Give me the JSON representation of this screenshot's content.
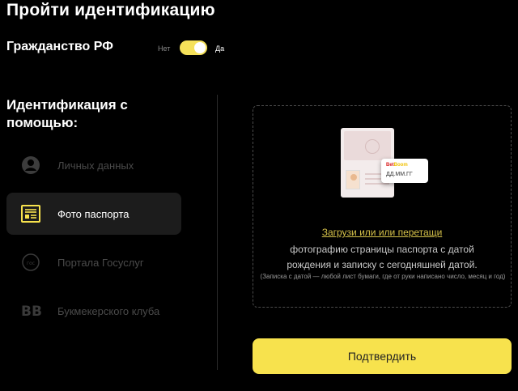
{
  "page": {
    "title": "Пройти идентификацию"
  },
  "citizenship": {
    "label": "Гражданство РФ",
    "toggle_no": "Нет",
    "toggle_yes": "Да",
    "enabled": true
  },
  "methods_heading": "Идентификация с помощью:",
  "methods": [
    {
      "label": "Личных данных",
      "icon": "person-icon",
      "active": false
    },
    {
      "label": "Фото паспорта",
      "icon": "passport-icon",
      "active": true
    },
    {
      "label": "Портала Госуслуг",
      "icon": "gosuslugi-icon",
      "active": false
    },
    {
      "label": "Букмекерского клуба",
      "icon": "bb-logo-icon",
      "icon_text": "BB",
      "active": false
    }
  ],
  "upload": {
    "illustration": {
      "note_brand_a": "Bet",
      "note_brand_b": "Boom",
      "note_date": "ДД.ММ.ГГ"
    },
    "link_text": "Загрузи или или перетащи",
    "text_line1": "фотографию страницы паспорта с датой",
    "text_line2": "рождения и записку с сегодняшней датой.",
    "note": "(Записка с датой — любой лист бумаги, где от руки написано число, месяц и год)"
  },
  "confirm_button": "Подтвердить",
  "colors": {
    "accent": "#f7e24d",
    "background": "#000000",
    "active_item_bg": "#1c1c1c",
    "inactive_text": "#4a4a4a"
  }
}
